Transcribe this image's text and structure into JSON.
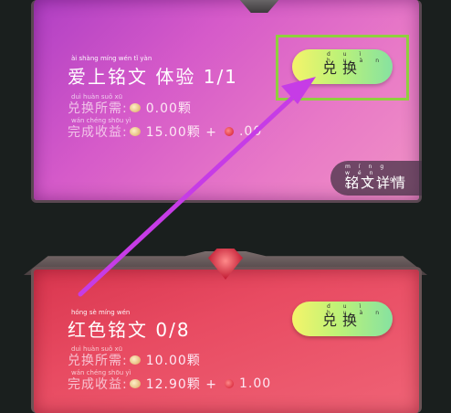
{
  "card1": {
    "title_pinyin": "ài shàng míng wén   tǐ yàn",
    "title": "爱上铭文 体验 1/1",
    "cost_pinyin": "duì huàn suǒ xū",
    "cost_label": "兑换所需:",
    "cost_value": "0.00颗",
    "reward_pinyin": "wán chéng shōu yì",
    "reward_label": "完成收益:",
    "reward_value_bean": "15.00颗 +",
    "reward_value_red": ".00",
    "button_pinyin": "duì huàn",
    "button_label": "兑换",
    "detail_pinyin": "míng wén xiáng qíng",
    "detail_label": "铭文详情"
  },
  "card2": {
    "title_pinyin": "hóng sè míng wén",
    "title": "红色铭文 0/8",
    "cost_pinyin": "duì huàn suǒ xū",
    "cost_label": "兑换所需:",
    "cost_value": "10.00颗",
    "reward_pinyin": "wán chéng shōu yì",
    "reward_label": "完成收益:",
    "reward_value_bean": "12.90颗 +",
    "reward_value_red": "1.00",
    "button_pinyin": "duì huàn",
    "button_label": "兑换"
  },
  "colors": {
    "highlight": "#8fcf3e",
    "arrow": "#c63ce6"
  }
}
